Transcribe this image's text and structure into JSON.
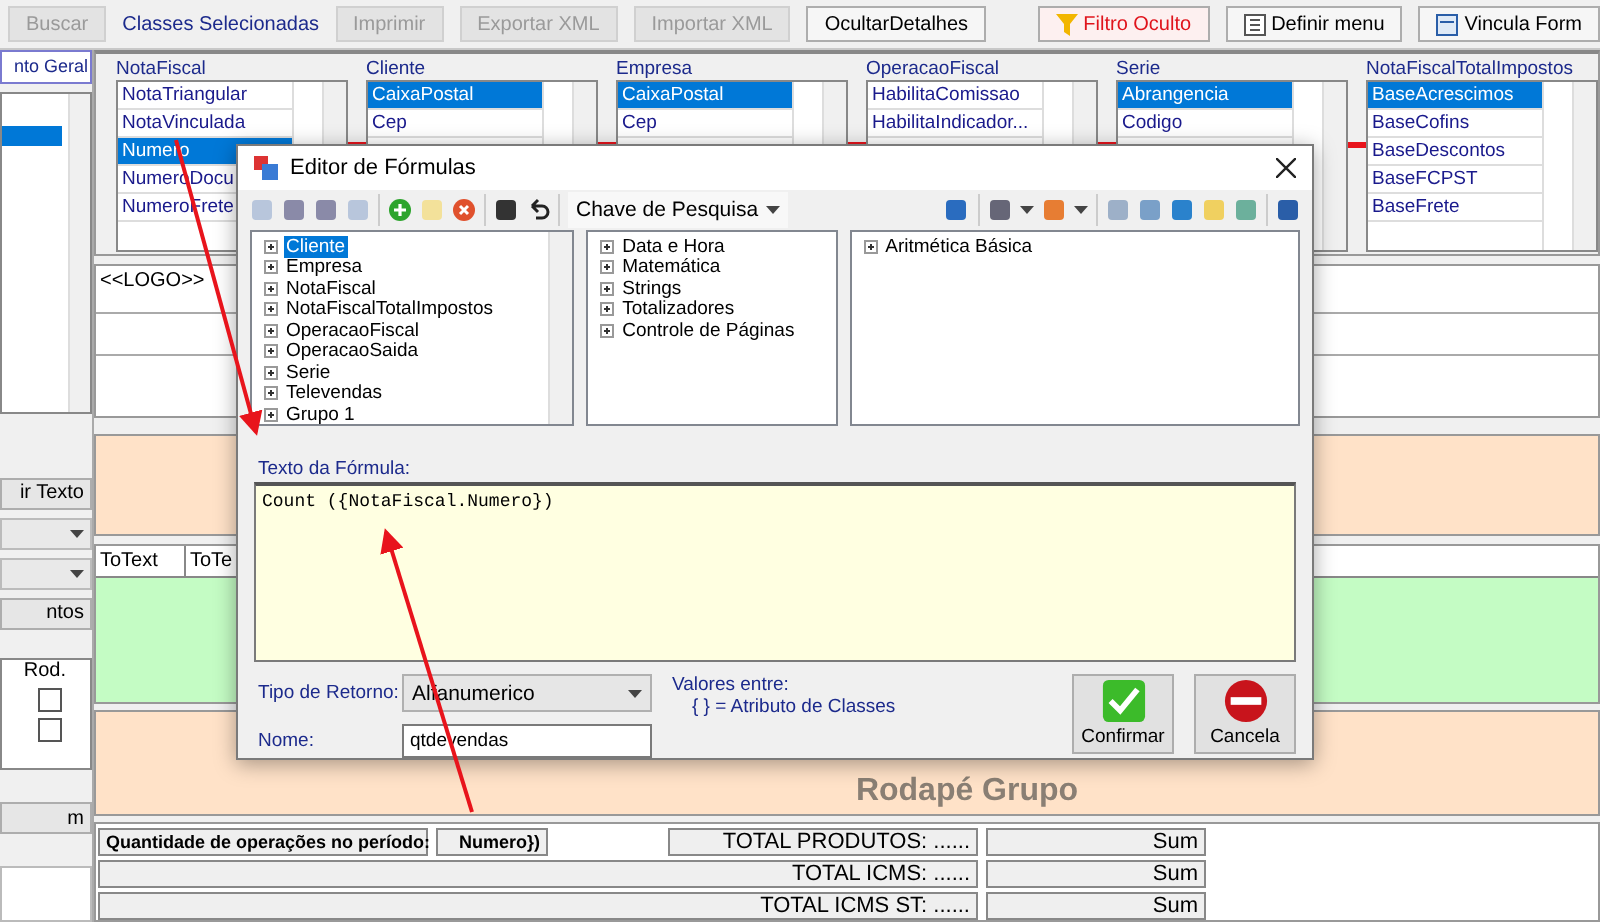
{
  "toolbar": {
    "search_button": {
      "label": "Buscar",
      "disabled": true
    },
    "classes_label": "Classes Selecionadas",
    "buttons": [
      {
        "label": "Imprimir",
        "disabled": true
      },
      {
        "label": "Exportar XML",
        "disabled": true
      },
      {
        "label": "Importar XML",
        "disabled": true
      },
      {
        "label": "OcultarDetalhes",
        "disabled": false
      }
    ],
    "right_buttons": [
      {
        "label": "Filtro Oculto",
        "kind": "filter"
      },
      {
        "label": "Definir menu",
        "kind": "menu"
      },
      {
        "label": "Vincula Form",
        "kind": "link"
      }
    ]
  },
  "left_panel": {
    "tab": "nto Geral",
    "text_button": "ir Texto",
    "elements_button": "ntos",
    "table_header": "Rod.",
    "rows": [
      {
        "checked": false
      },
      {
        "checked": false
      }
    ],
    "bottom_button": "m"
  },
  "classes": [
    {
      "name": "NotaFiscal",
      "items": [
        {
          "label": "NotaTriangular",
          "selected": false
        },
        {
          "label": "NotaVinculada",
          "selected": false
        },
        {
          "label": "Numero",
          "selected": true
        },
        {
          "label": "NumeroDocu",
          "selected": false
        },
        {
          "label": "NumeroFrete",
          "selected": false
        }
      ]
    },
    {
      "name": "Cliente",
      "items": [
        {
          "label": "CaixaPostal",
          "selected": true
        },
        {
          "label": "Cep",
          "selected": false
        }
      ]
    },
    {
      "name": "Empresa",
      "items": [
        {
          "label": "CaixaPostal",
          "selected": true
        },
        {
          "label": "Cep",
          "selected": false
        }
      ]
    },
    {
      "name": "OperacaoFiscal",
      "items": [
        {
          "label": "HabilitaComissao",
          "selected": false
        },
        {
          "label": "HabilitaIndicador...",
          "selected": false
        }
      ]
    },
    {
      "name": "Serie",
      "items": [
        {
          "label": "Abrangencia",
          "selected": true
        },
        {
          "label": "Codigo",
          "selected": false
        }
      ]
    },
    {
      "name": "NotaFiscalTotalImpostos",
      "items": [
        {
          "label": "BaseAcrescimos",
          "selected": true
        },
        {
          "label": "BaseCofins",
          "selected": false
        },
        {
          "label": "BaseDescontos",
          "selected": false
        },
        {
          "label": "BaseFCPST",
          "selected": false
        },
        {
          "label": "BaseFrete",
          "selected": false
        }
      ]
    }
  ],
  "report": {
    "logo_field": "<<LOGO>>",
    "detail_headers": [
      "ToText",
      "ToTe"
    ],
    "group_footer_label": "Rodapé Grupo",
    "summary": {
      "quantity_label": "Quantidade de operações no período:",
      "quantity_value": "Numero})",
      "rows": [
        {
          "label": "TOTAL PRODUTOS: ......",
          "value": "Sum"
        },
        {
          "label": "TOTAL ICMS: ......",
          "value": "Sum"
        },
        {
          "label": "TOTAL ICMS ST: ......",
          "value": "Sum"
        }
      ]
    }
  },
  "dialog": {
    "title": "Editor de Fórmulas",
    "search_key": "Chave de Pesquisa",
    "trees": [
      [
        {
          "label": "Cliente",
          "selected": true
        },
        {
          "label": "Empresa",
          "selected": false
        },
        {
          "label": "NotaFiscal",
          "selected": false
        },
        {
          "label": "NotaFiscalTotalImpostos",
          "selected": false
        },
        {
          "label": "OperacaoFiscal",
          "selected": false
        },
        {
          "label": "OperacaoSaida",
          "selected": false
        },
        {
          "label": "Serie",
          "selected": false
        },
        {
          "label": "Televendas",
          "selected": false
        },
        {
          "label": "Grupo 1",
          "selected": false
        }
      ],
      [
        {
          "label": "Data e Hora",
          "selected": false
        },
        {
          "label": "Matemática",
          "selected": false
        },
        {
          "label": "Strings",
          "selected": false
        },
        {
          "label": "Totalizadores",
          "selected": false
        },
        {
          "label": "Controle de Páginas",
          "selected": false
        }
      ],
      [
        {
          "label": "Aritmética Básica",
          "selected": false
        }
      ]
    ],
    "formula_label": "Texto da Fórmula:",
    "formula": "Count ({NotaFiscal.Numero})",
    "return_type_label": "Tipo de Retorno:",
    "return_type": "Alfanumerico",
    "values_label": "Valores entre:",
    "values_hint": "{ } = Atributo de Classes",
    "name_label": "Nome:",
    "name": "qtdevendas",
    "confirm": "Confirmar",
    "cancel": "Cancela"
  }
}
